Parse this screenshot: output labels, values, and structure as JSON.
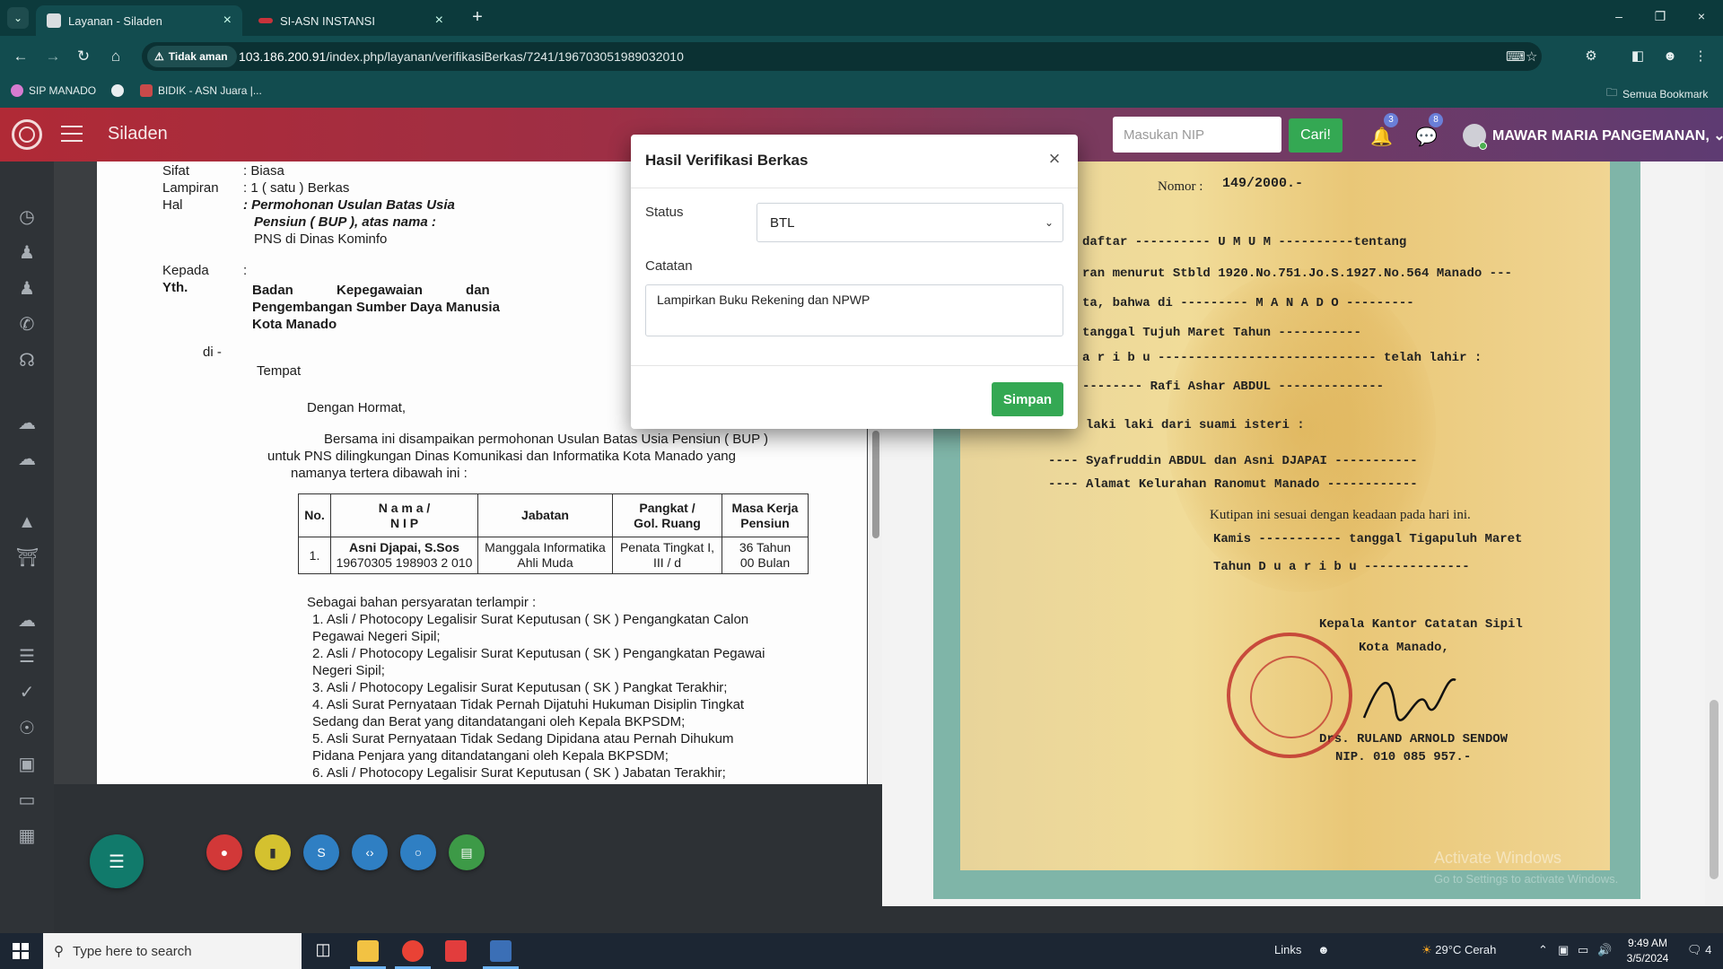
{
  "browser": {
    "tabs": [
      {
        "label": "Layanan - Siladen",
        "active": true
      },
      {
        "label": "SI-ASN INSTANSI",
        "active": false
      }
    ],
    "security_label": "Tidak aman",
    "url_host": "103.186.200.91",
    "url_path": "/index.php/layanan/verifikasiBerkas/7241/196703051989032010",
    "bookmarks": [
      "SIP MANADO",
      "BIDIK - ASN Juara |...",
      "Semua Bookmark"
    ]
  },
  "app": {
    "title": "Siladen",
    "search_placeholder": "Masukan NIP",
    "search_button": "Cari!",
    "notifications_count": "3",
    "messages_count": "8",
    "username": "MAWAR MARIA PANGEMANAN,",
    "accent_color": "#b02a36",
    "success_color": "#34a853"
  },
  "sidebar": {
    "icons": [
      "dashboard-icon",
      "user-icon",
      "user-alt-icon",
      "whatsapp-icon",
      "headset-icon",
      "cloud-upload-icon",
      "cloud-download-icon",
      "graduation-icon",
      "bank-icon",
      "cloud-download-2-icon",
      "list-icon",
      "check-circle-icon",
      "globe-icon",
      "contact-icon",
      "monitor-icon",
      "grid-icon"
    ]
  },
  "letter": {
    "sifat_label": "Sifat",
    "sifat_value": ": Biasa",
    "lampiran_label": "Lampiran",
    "lampiran_value": ": 1 ( satu ) Berkas",
    "hal_label": "Hal",
    "hal_value_1": ": Permohonan Usulan Batas Usia",
    "hal_value_2": "Pensiun ( BUP ), atas nama :",
    "hal_value_3": "PNS di Dinas Kominfo",
    "kepada": "Kepada",
    "kepada_colon": ":",
    "yth": "Yth.",
    "to_1": "Badan Kepegawaian dan",
    "to_2": "Pengembangan Sumber Daya Manusia",
    "to_3": "Kota Manado",
    "di": "di -",
    "tempat": "Tempat",
    "greeting": "Dengan Hormat,",
    "body_1": "Bersama ini disampaikan permohonan Usulan Batas Usia Pensiun ( BUP )",
    "body_2": "untuk PNS dilingkungan Dinas Komunikasi dan Informatika Kota Manado yang",
    "body_3": "namanya tertera dibawah ini :",
    "table_headers": [
      "No.",
      "N a m a /\nN I P",
      "Jabatan",
      "Pangkat /\nGol. Ruang",
      "Masa Kerja\nPensiun"
    ],
    "table_row": {
      "no": "1.",
      "nama": "Asni Djapai, S.Sos",
      "nip": "19670305 198903 2 010",
      "jabatan_1": "Manggala Informatika",
      "jabatan_2": "Ahli Muda",
      "pangkat_1": "Penata Tingkat I,",
      "pangkat_2": "III / d",
      "masa_1": "36 Tahun",
      "masa_2": "00 Bulan"
    },
    "req_intro": "Sebagai bahan persyaratan terlampir :",
    "requirements": [
      "1.  Asli / Photocopy Legalisir Surat Keputusan ( SK ) Pengangkatan Calon",
      "     Pegawai Negeri Sipil;",
      "2.  Asli / Photocopy Legalisir Surat Keputusan ( SK ) Pengangkatan Pegawai",
      "     Negeri Sipil;",
      "3.  Asli / Photocopy Legalisir Surat Keputusan ( SK ) Pangkat Terakhir;",
      "4.  Asli Surat Pernyataan Tidak Pernah Dijatuhi Hukuman Disiplin Tingkat",
      "     Sedang dan Berat yang ditandatangani oleh Kepala BKPSDM;",
      "5.  Asli Surat Pernyataan Tidak Sedang Dipidana atau Pernah Dihukum",
      "     Pidana Penjara yang ditandatangani oleh Kepala BKPSDM;",
      "6.  Asli / Photocopy Legalisir Surat Keputusan ( SK ) Jabatan Terakhir;"
    ]
  },
  "certificate": {
    "nomor_label": "Nomor :",
    "nomor_value": "149/2000.-",
    "lines": [
      "daftar ---------- U M U M ----------tentang",
      "ran menurut Stbld 1920.No.751.Jo.S.1927.No.564  Manado ---",
      "ta, bahwa di --------- M A N A D O ---------",
      "tanggal  Tujuh   Maret   Tahun  -----------",
      "a r i b u ----------------------------- telah lahir :",
      "-------- Rafi Ashar ABDUL --------------",
      "---- laki laki dari suami isteri :",
      "---- Syafruddin ABDUL  dan Asni DJAPAI -----------",
      "---- Alamat Kelurahan Ranomut Manado ------------",
      "Kutipan ini sesuai dengan keadaan pada hari ini.",
      "Kamis ----------- tanggal Tigapuluh Maret",
      "Tahun  D u a r i b u --------------",
      "Kepala Kantor Catatan Sipil",
      "Kota Manado,",
      "Drs. RULAND ARNOLD SENDOW",
      "NIP. 010 085 957.-"
    ]
  },
  "modal": {
    "title": "Hasil Verifikasi Berkas",
    "status_label": "Status",
    "status_value": "BTL",
    "catatan_label": "Catatan",
    "catatan_value": "Lampirkan Buku Rekening dan NPWP",
    "save_button": "Simpan"
  },
  "windows": {
    "activate_title": "Activate Windows",
    "activate_sub": "Go to Settings to activate Windows.",
    "search_placeholder": "Type here to search",
    "links_label": "Links",
    "weather": "29°C  Cerah",
    "time": "9:49 AM",
    "date": "3/5/2024",
    "notif_count": "4"
  }
}
